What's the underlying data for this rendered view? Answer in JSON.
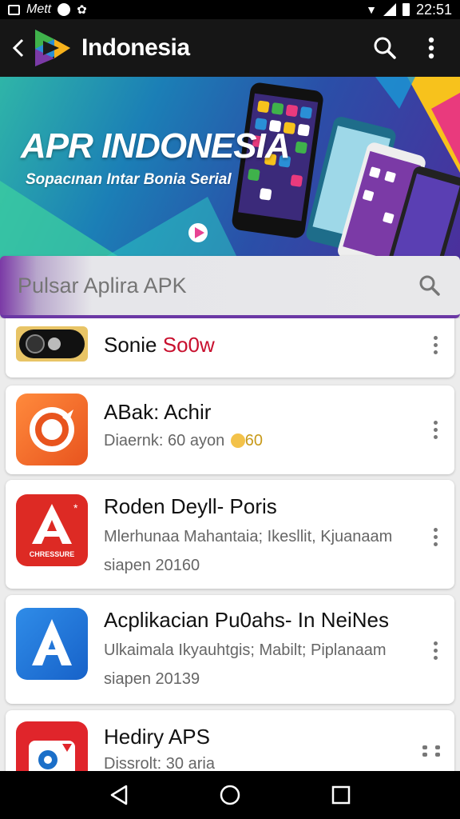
{
  "status_bar": {
    "carrier": "Mett",
    "time": "22:51"
  },
  "app_bar": {
    "title": "Indonesia"
  },
  "banner": {
    "title": "APR INDONESIA",
    "subtitle": "Sopacınan Intar Bonia Serial"
  },
  "search": {
    "placeholder": "Pulsar Aplira APK"
  },
  "list": {
    "items": [
      {
        "name": "Sonie",
        "name_accent": "So0w",
        "desc": "",
        "desc2": ""
      },
      {
        "name": "ABak: Achir",
        "name_accent": "",
        "desc": "Diaernk: 60 ayon",
        "desc_suffix": "60",
        "desc2": ""
      },
      {
        "name": "Roden Deyll- Poris",
        "name_accent": "",
        "desc": "Mlerhunaa Mahantaia; Ikesllit, Kjuanaam",
        "desc2": "siapen 20160"
      },
      {
        "name": "Acplikacian Pu0ahs- In NeiNes",
        "name_accent": "",
        "desc": "Ulkaimala Ikyauhtgis; Mabilt; Piplanaam",
        "desc2": "siapen 20139"
      },
      {
        "name": "Hediry APS",
        "name_accent": "",
        "desc": "Dissrolt: 30 aria",
        "desc2": ""
      }
    ],
    "icon_badge_text": "CHRESSURE"
  },
  "colors": {
    "accent": "#6b38a5",
    "app_bar": "#161616"
  }
}
